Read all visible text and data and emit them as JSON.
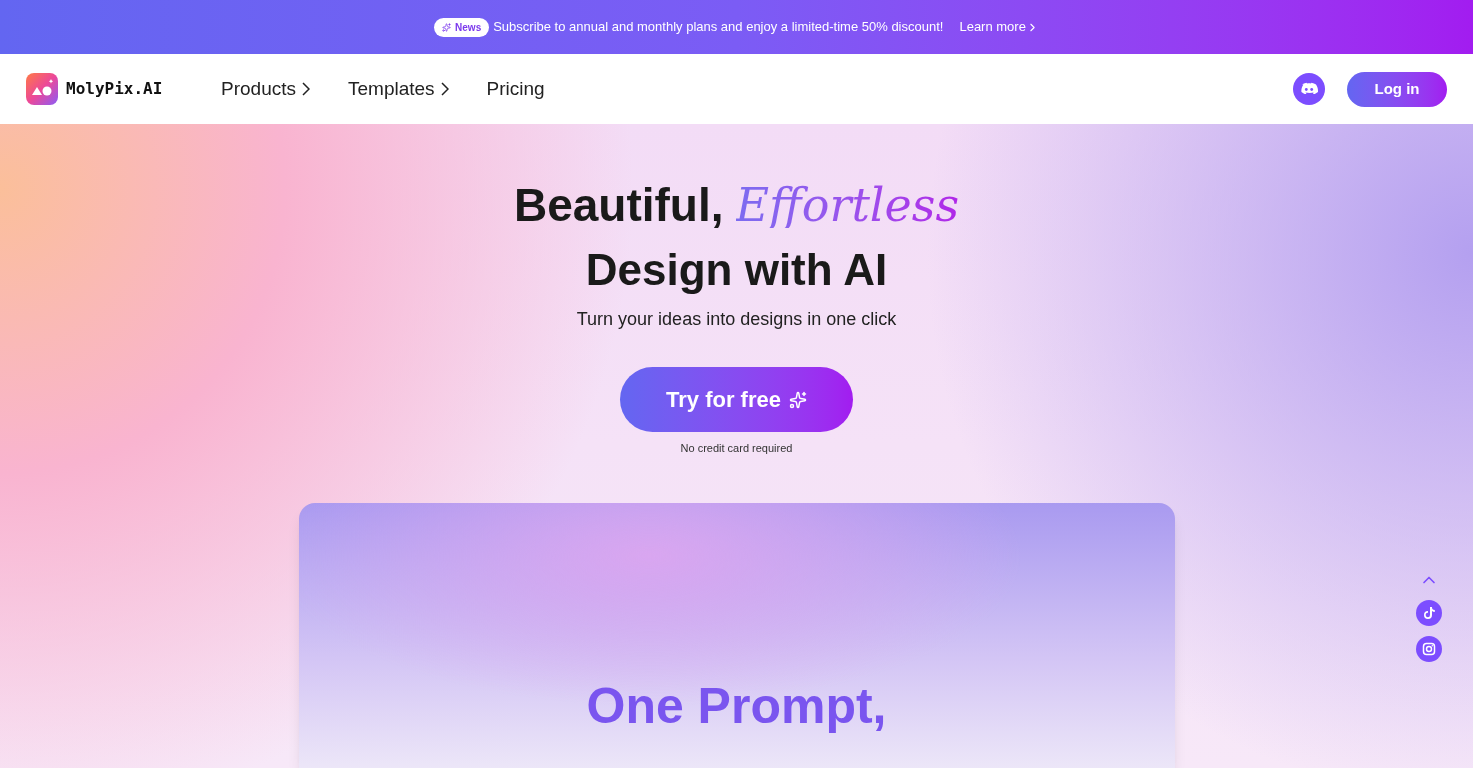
{
  "announcement": {
    "badge": "News",
    "text": "Subscribe to annual and monthly plans and enjoy a limited-time 50% discount!",
    "link": "Learn more"
  },
  "nav": {
    "brand": "MolyPix.AI",
    "items": [
      {
        "label": "Products",
        "has_submenu": true
      },
      {
        "label": "Templates",
        "has_submenu": true
      },
      {
        "label": "Pricing",
        "has_submenu": false
      }
    ],
    "login": "Log in"
  },
  "hero": {
    "title_start": "Beautiful,",
    "title_accent": "Effortless",
    "title_line2": "Design with AI",
    "subtitle": "Turn your ideas into designs in one click",
    "cta": "Try for free",
    "cta_note": "No credit card required"
  },
  "showcase": {
    "heading": "One Prompt,"
  }
}
